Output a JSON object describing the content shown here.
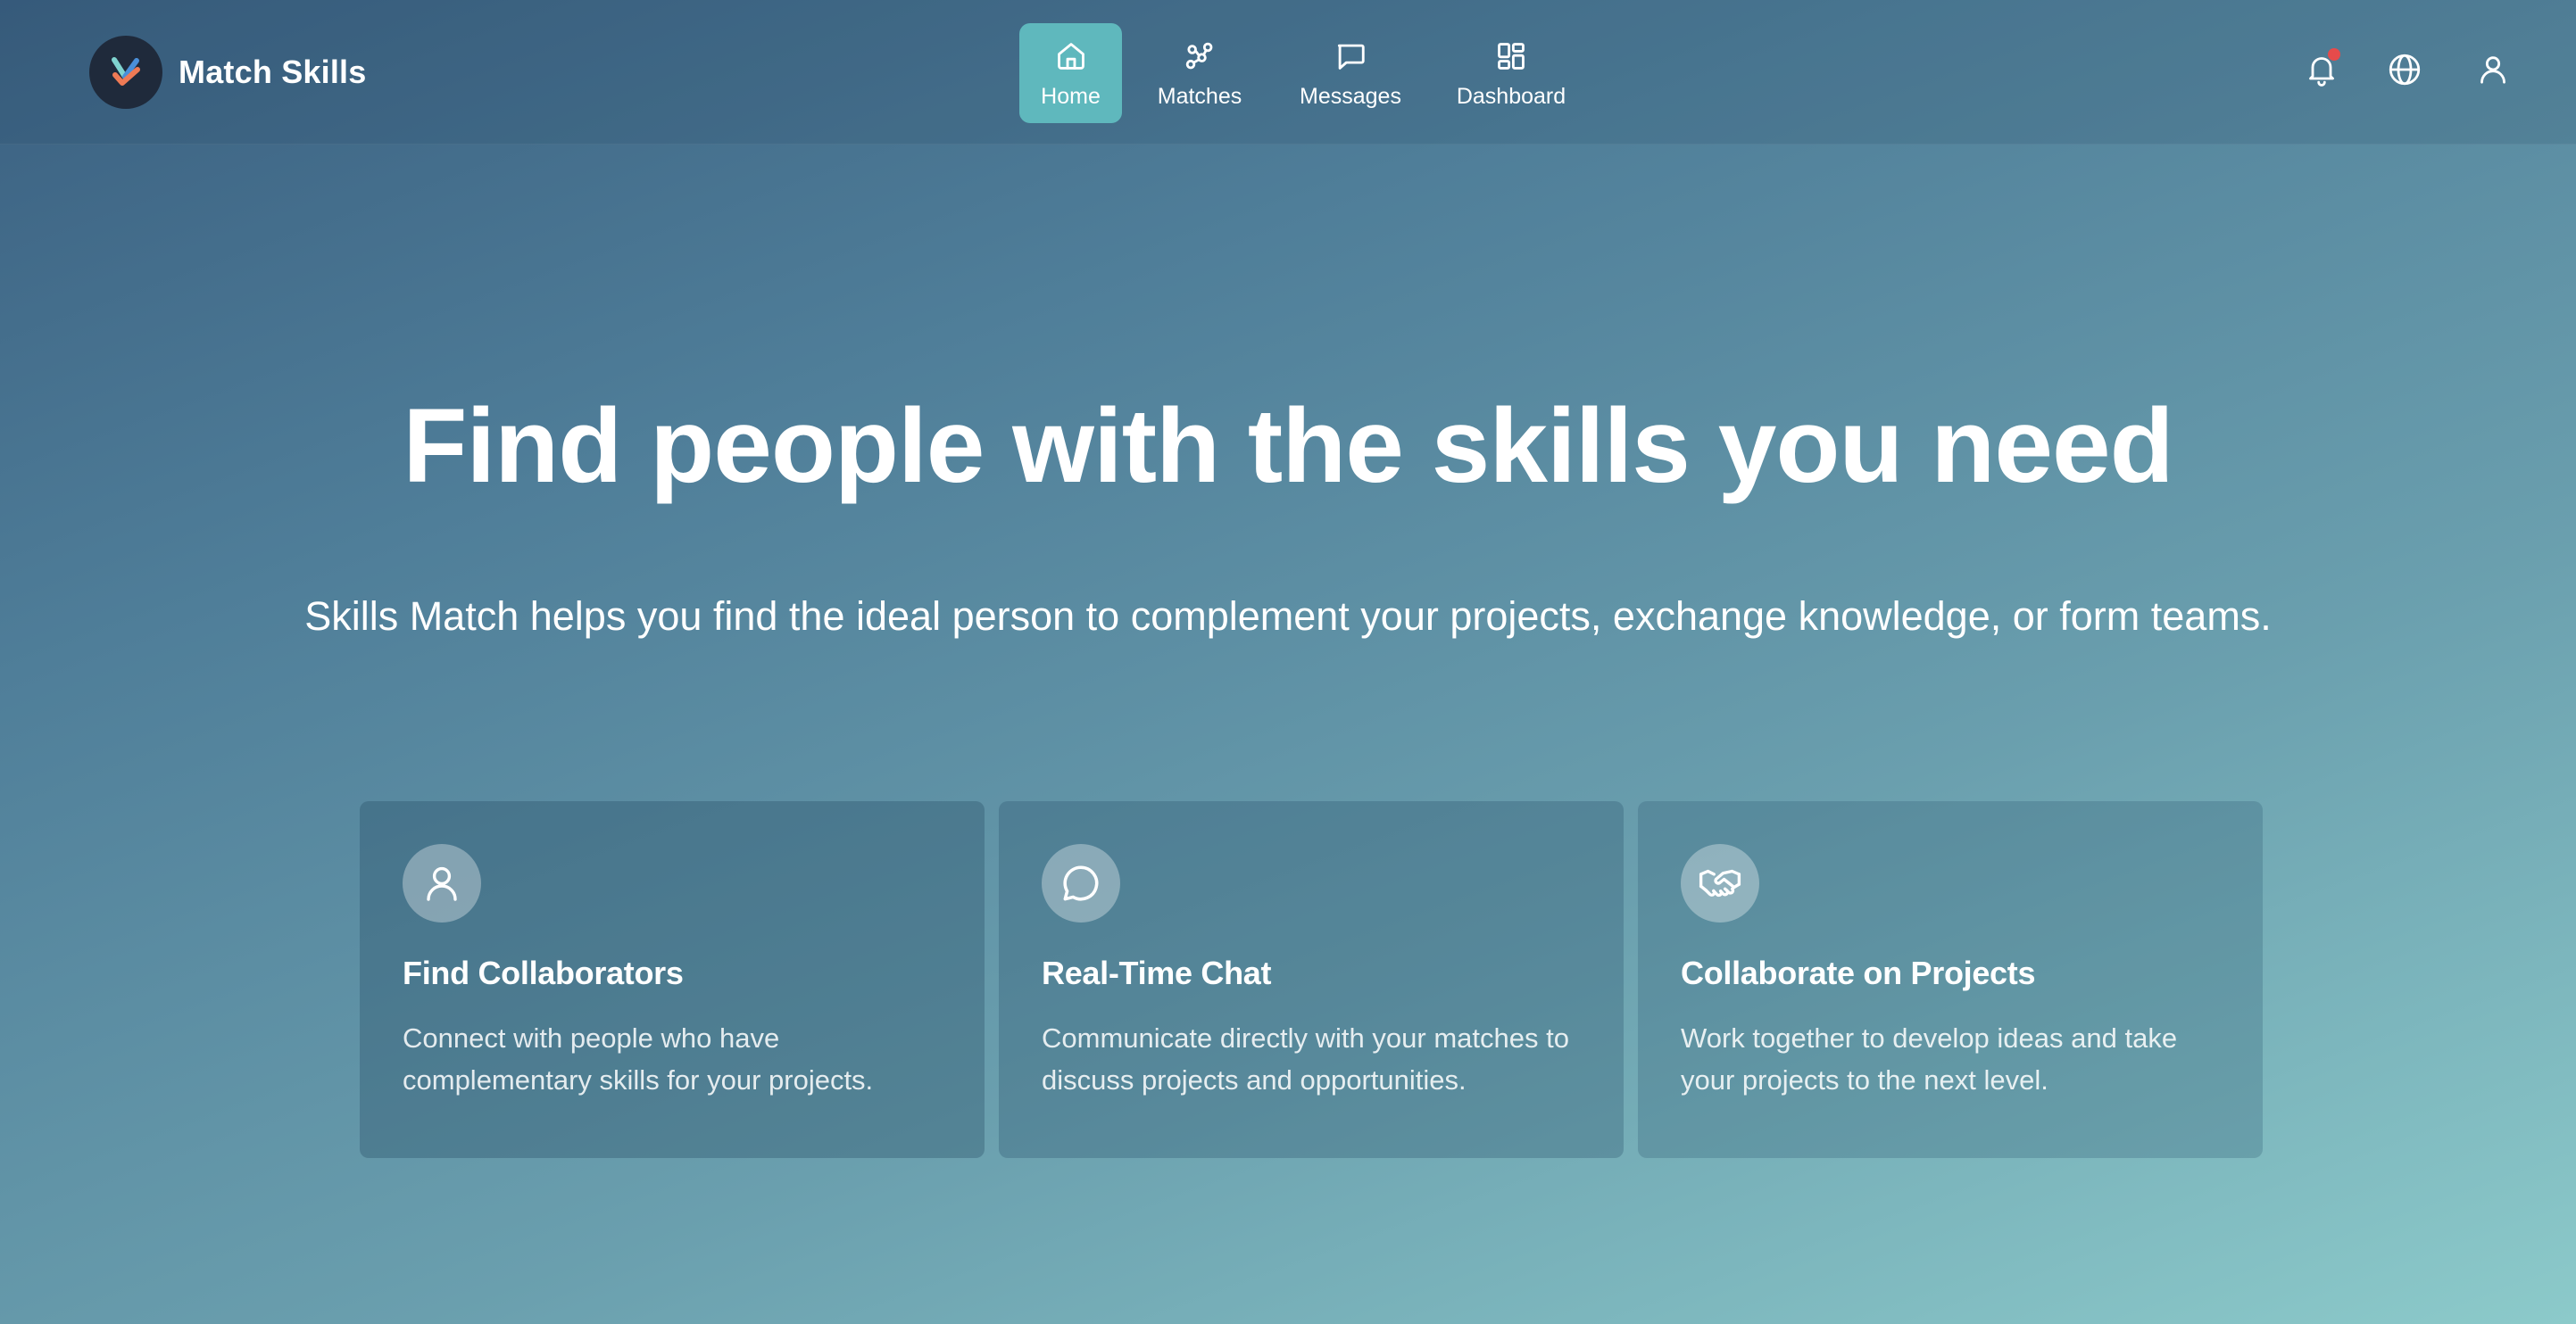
{
  "brand": {
    "name": "Match Skills",
    "logo_icon": "brand-check-logo"
  },
  "nav": {
    "items": [
      {
        "label": "Home",
        "icon": "home-icon",
        "active": true
      },
      {
        "label": "Matches",
        "icon": "network-icon",
        "active": false
      },
      {
        "label": "Messages",
        "icon": "message-icon",
        "active": false
      },
      {
        "label": "Dashboard",
        "icon": "dashboard-icon",
        "active": false
      }
    ]
  },
  "actions": {
    "notifications_icon": "bell-icon",
    "has_unread_notifications": true,
    "language_icon": "globe-icon",
    "profile_icon": "user-icon"
  },
  "hero": {
    "title": "Find people with the skills you need",
    "subtitle": "Skills Match helps you find the ideal person to complement your projects, exchange knowledge, or form teams."
  },
  "features": [
    {
      "icon": "user-icon",
      "title": "Find Collaborators",
      "description": "Connect with people who have complementary skills for your projects."
    },
    {
      "icon": "chat-bubble-icon",
      "title": "Real-Time Chat",
      "description": "Communicate directly with your matches to discuss projects and opportunities."
    },
    {
      "icon": "handshake-icon",
      "title": "Collaborate on Projects",
      "description": "Work together to develop ideas and take your projects to the next level."
    }
  ],
  "colors": {
    "active_nav": "#5fb8bd",
    "notification_dot": "#e64b4b",
    "logo_bg": "#1f2a3b"
  }
}
